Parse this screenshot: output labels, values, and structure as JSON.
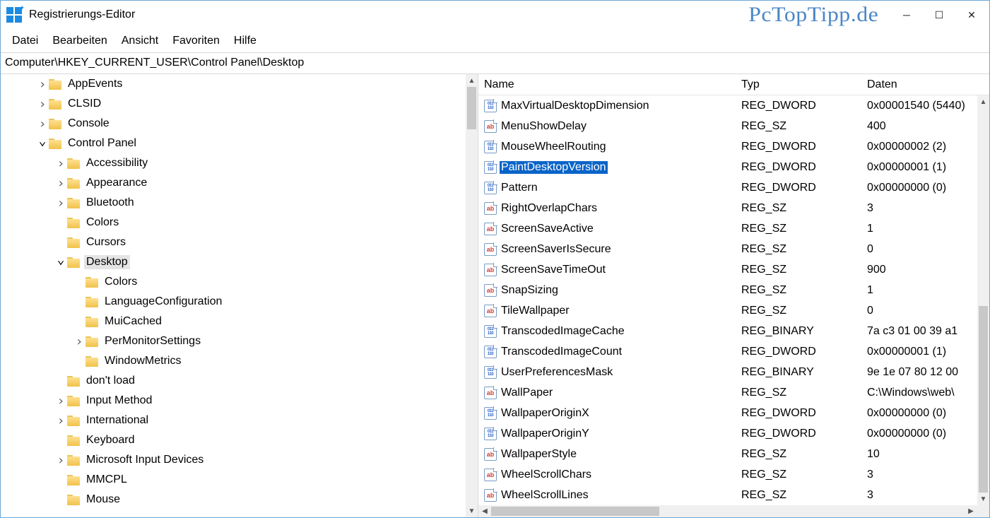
{
  "window": {
    "title": "Registrierungs-Editor",
    "logo": "PcTopTipp.de"
  },
  "menu": [
    "Datei",
    "Bearbeiten",
    "Ansicht",
    "Favoriten",
    "Hilfe"
  ],
  "address": "Computer\\HKEY_CURRENT_USER\\Control Panel\\Desktop",
  "tree": [
    {
      "level": 2,
      "exp": ">",
      "label": "AppEvents"
    },
    {
      "level": 2,
      "exp": ">",
      "label": "CLSID"
    },
    {
      "level": 2,
      "exp": ">",
      "label": "Console"
    },
    {
      "level": 2,
      "exp": "v",
      "label": "Control Panel"
    },
    {
      "level": 3,
      "exp": ">",
      "label": "Accessibility"
    },
    {
      "level": 3,
      "exp": ">",
      "label": "Appearance"
    },
    {
      "level": 3,
      "exp": ">",
      "label": "Bluetooth"
    },
    {
      "level": 3,
      "exp": "",
      "label": "Colors"
    },
    {
      "level": 3,
      "exp": "",
      "label": "Cursors"
    },
    {
      "level": 3,
      "exp": "v",
      "label": "Desktop",
      "selected": true
    },
    {
      "level": 4,
      "exp": "",
      "label": "Colors"
    },
    {
      "level": 4,
      "exp": "",
      "label": "LanguageConfiguration"
    },
    {
      "level": 4,
      "exp": "",
      "label": "MuiCached"
    },
    {
      "level": 4,
      "exp": ">",
      "label": "PerMonitorSettings"
    },
    {
      "level": 4,
      "exp": "",
      "label": "WindowMetrics"
    },
    {
      "level": 3,
      "exp": "",
      "label": "don't load"
    },
    {
      "level": 3,
      "exp": ">",
      "label": "Input Method"
    },
    {
      "level": 3,
      "exp": ">",
      "label": "International"
    },
    {
      "level": 3,
      "exp": "",
      "label": "Keyboard"
    },
    {
      "level": 3,
      "exp": ">",
      "label": "Microsoft Input Devices"
    },
    {
      "level": 3,
      "exp": "",
      "label": "MMCPL"
    },
    {
      "level": 3,
      "exp": "",
      "label": "Mouse"
    }
  ],
  "columns": {
    "name": "Name",
    "type": "Typ",
    "data": "Daten"
  },
  "values": [
    {
      "icon": "nn",
      "name": "MaxVirtualDesktopDimension",
      "type": "REG_DWORD",
      "data": "0x00001540 (5440)"
    },
    {
      "icon": "ab",
      "name": "MenuShowDelay",
      "type": "REG_SZ",
      "data": "400"
    },
    {
      "icon": "nn",
      "name": "MouseWheelRouting",
      "type": "REG_DWORD",
      "data": "0x00000002 (2)"
    },
    {
      "icon": "nn",
      "name": "PaintDesktopVersion",
      "type": "REG_DWORD",
      "data": "0x00000001 (1)",
      "selected": true
    },
    {
      "icon": "nn",
      "name": "Pattern",
      "type": "REG_DWORD",
      "data": "0x00000000 (0)"
    },
    {
      "icon": "ab",
      "name": "RightOverlapChars",
      "type": "REG_SZ",
      "data": "3"
    },
    {
      "icon": "ab",
      "name": "ScreenSaveActive",
      "type": "REG_SZ",
      "data": "1"
    },
    {
      "icon": "ab",
      "name": "ScreenSaverIsSecure",
      "type": "REG_SZ",
      "data": "0"
    },
    {
      "icon": "ab",
      "name": "ScreenSaveTimeOut",
      "type": "REG_SZ",
      "data": "900"
    },
    {
      "icon": "ab",
      "name": "SnapSizing",
      "type": "REG_SZ",
      "data": "1"
    },
    {
      "icon": "ab",
      "name": "TileWallpaper",
      "type": "REG_SZ",
      "data": "0"
    },
    {
      "icon": "nn",
      "name": "TranscodedImageCache",
      "type": "REG_BINARY",
      "data": "7a c3 01 00 39 a1"
    },
    {
      "icon": "nn",
      "name": "TranscodedImageCount",
      "type": "REG_DWORD",
      "data": "0x00000001 (1)"
    },
    {
      "icon": "nn",
      "name": "UserPreferencesMask",
      "type": "REG_BINARY",
      "data": "9e 1e 07 80 12 00"
    },
    {
      "icon": "ab",
      "name": "WallPaper",
      "type": "REG_SZ",
      "data": "C:\\Windows\\web\\"
    },
    {
      "icon": "nn",
      "name": "WallpaperOriginX",
      "type": "REG_DWORD",
      "data": "0x00000000 (0)"
    },
    {
      "icon": "nn",
      "name": "WallpaperOriginY",
      "type": "REG_DWORD",
      "data": "0x00000000 (0)"
    },
    {
      "icon": "ab",
      "name": "WallpaperStyle",
      "type": "REG_SZ",
      "data": "10"
    },
    {
      "icon": "ab",
      "name": "WheelScrollChars",
      "type": "REG_SZ",
      "data": "3"
    },
    {
      "icon": "ab",
      "name": "WheelScrollLines",
      "type": "REG_SZ",
      "data": "3"
    }
  ],
  "iconText": {
    "ab": "ab",
    "nn": "011 110"
  }
}
